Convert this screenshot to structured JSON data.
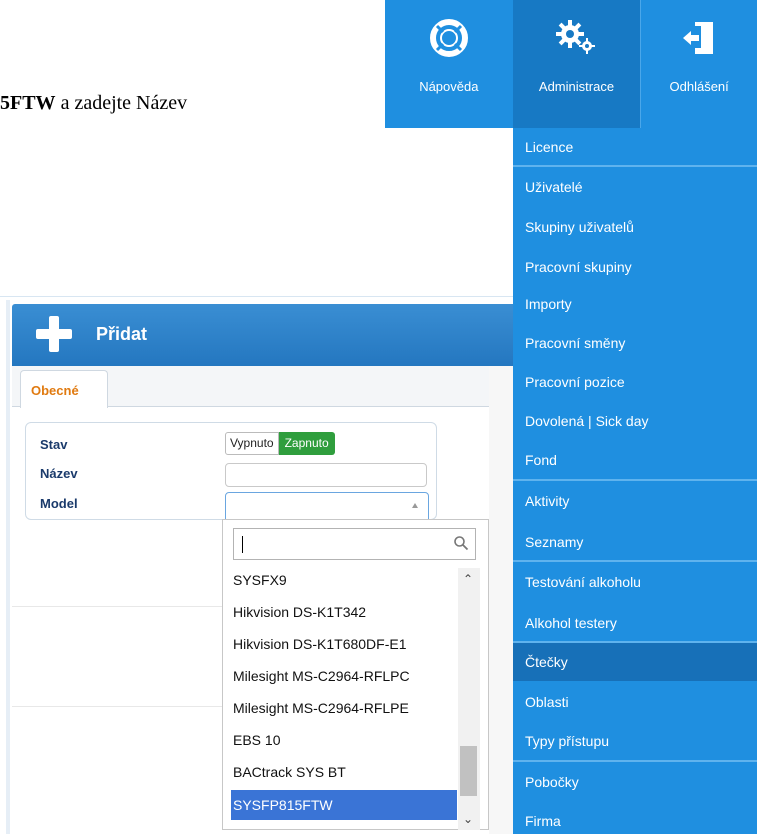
{
  "instruction": {
    "bold_part": "5FTW",
    "rest": " a zadejte Název"
  },
  "topnav": {
    "help_label": "Nápověda",
    "admin_label": "Administrace",
    "logout_label": "Odhlášení"
  },
  "menu": {
    "items": [
      "Licence",
      "Uživatelé",
      "Skupiny uživatelů",
      "Pracovní skupiny",
      "Importy",
      "Pracovní směny",
      "Pracovní pozice",
      "Dovolená | Sick day",
      "Fond",
      "Aktivity",
      "Seznamy",
      "Testování alkoholu",
      "Alkohol testery",
      "Čtečky",
      "Oblasti",
      "Typy přístupu",
      "Pobočky",
      "Firma"
    ],
    "active": "Čtečky"
  },
  "panel": {
    "title": "Přidat",
    "tab": "Obecné",
    "labels": {
      "stav": "Stav",
      "nazev": "Název",
      "model": "Model"
    },
    "toggle_off": "Vypnuto",
    "toggle_on": "Zapnuto"
  },
  "dropdown": {
    "search_value": "",
    "options": [
      "SYSFX9",
      "Hikvision DS-K1T342",
      "Hikvision DS-K1T680DF-E1",
      "Milesight MS-C2964-RFLPC",
      "Milesight MS-C2964-RFLPE",
      "EBS 10",
      "BACtrack SYS BT",
      "SYSFP815FTW"
    ],
    "selected": "SYSFP815FTW"
  }
}
